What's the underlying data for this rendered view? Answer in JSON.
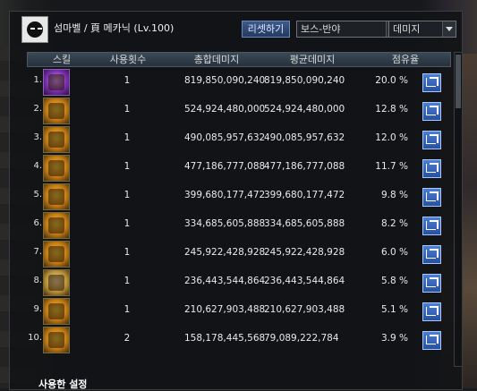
{
  "header": {
    "title": "섬마벨 / 頁 메카닉 (Lv.100)",
    "reset_label": "리셋하기",
    "boss_select": "보스-반야",
    "metric_select": "데미지"
  },
  "table": {
    "columns": [
      "스킬",
      "사용횟수",
      "총합데미지",
      "평균데미지",
      "점유율"
    ],
    "rows": [
      {
        "rank": "1.",
        "uses": "1",
        "total": "819,850,090,240",
        "avg": "819,850,090,240",
        "pct": "20.0 %",
        "icon": "skill-icon-purple"
      },
      {
        "rank": "2.",
        "uses": "1",
        "total": "524,924,480,000",
        "avg": "524,924,480,000",
        "pct": "12.8 %",
        "icon": "skill-icon-gold"
      },
      {
        "rank": "3.",
        "uses": "1",
        "total": "490,085,957,632",
        "avg": "490,085,957,632",
        "pct": "12.0 %",
        "icon": "skill-icon-gold"
      },
      {
        "rank": "4.",
        "uses": "1",
        "total": "477,186,777,088",
        "avg": "477,186,777,088",
        "pct": "11.7 %",
        "icon": "skill-icon-gold"
      },
      {
        "rank": "5.",
        "uses": "1",
        "total": "399,680,177,472",
        "avg": "399,680,177,472",
        "pct": "9.8 %",
        "icon": "skill-icon-gold"
      },
      {
        "rank": "6.",
        "uses": "1",
        "total": "334,685,605,888",
        "avg": "334,685,605,888",
        "pct": "8.2 %",
        "icon": "skill-icon-gold"
      },
      {
        "rank": "7.",
        "uses": "1",
        "total": "245,922,428,928",
        "avg": "245,922,428,928",
        "pct": "6.0 %",
        "icon": "skill-icon-gold"
      },
      {
        "rank": "8.",
        "uses": "1",
        "total": "236,443,544,864",
        "avg": "236,443,544,864",
        "pct": "5.8 %",
        "icon": "skill-icon-pale"
      },
      {
        "rank": "9.",
        "uses": "1",
        "total": "210,627,903,488",
        "avg": "210,627,903,488",
        "pct": "5.1 %",
        "icon": "skill-icon-gold"
      },
      {
        "rank": "10.",
        "uses": "2",
        "total": "158,178,445,568",
        "avg": "79,089,222,784",
        "pct": "3.9 %",
        "icon": "skill-icon-gold"
      }
    ]
  },
  "footer": {
    "label": "사용한 설정"
  },
  "colors": {
    "accent": "#2550a0",
    "header_bg": "#26313b",
    "panel_bg": "#121416"
  }
}
